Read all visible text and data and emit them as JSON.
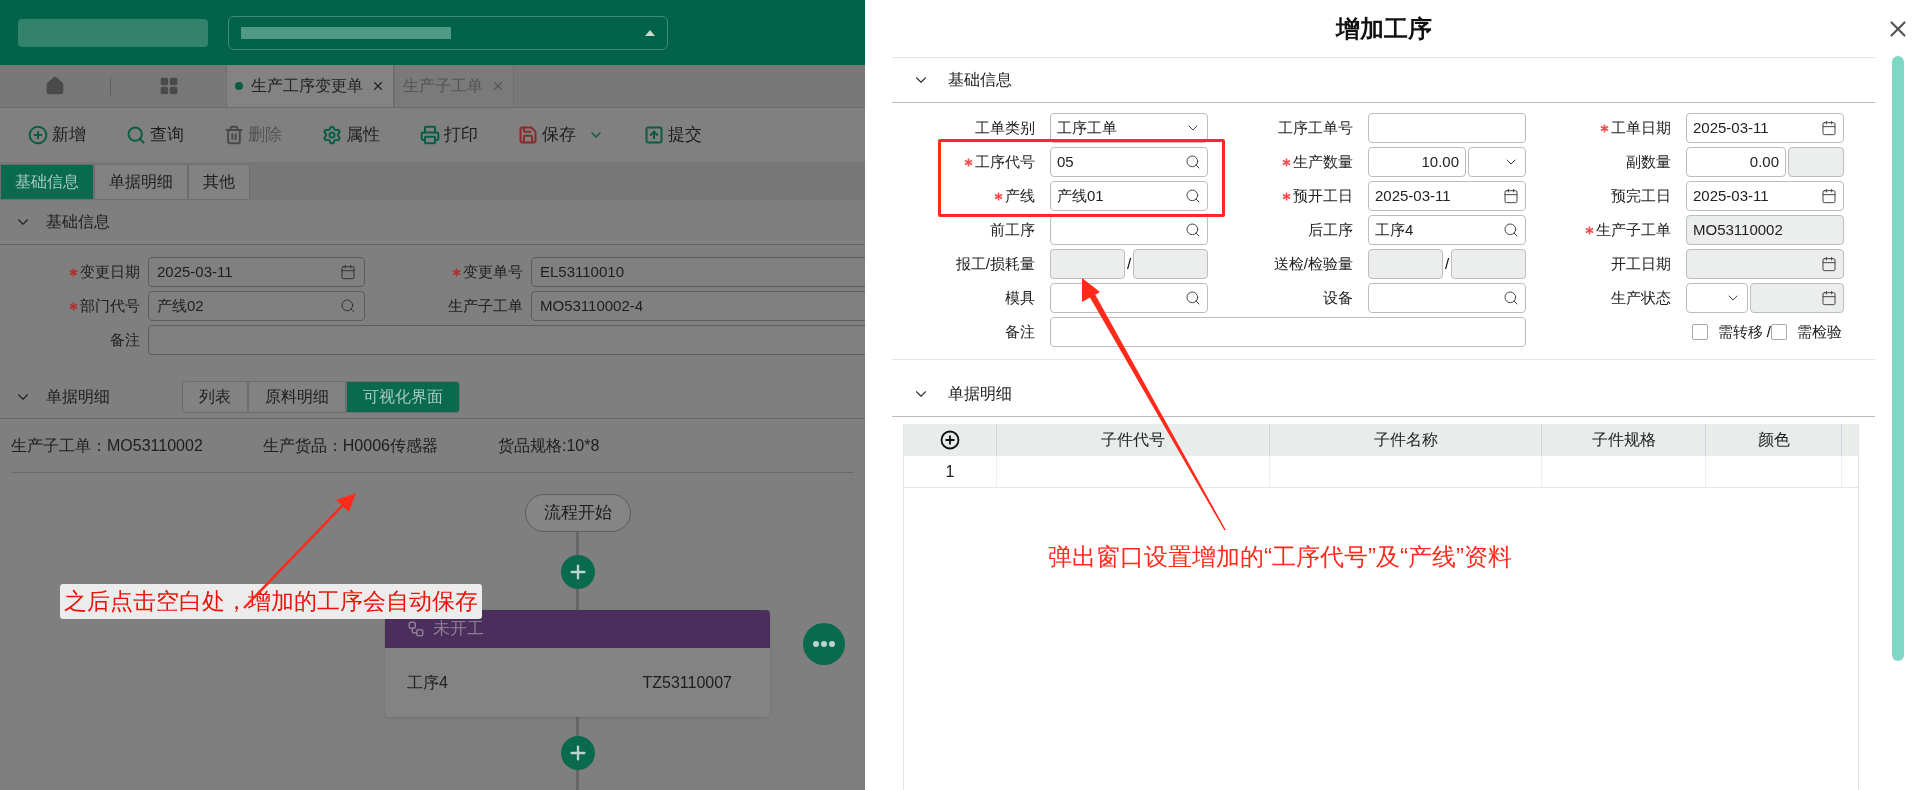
{
  "tabs": [
    {
      "label": "生产工序变更单",
      "selected": true,
      "closable": true
    },
    {
      "label": "生产子工单",
      "selected": false,
      "closable": true
    }
  ],
  "toolbar": [
    {
      "label": "新增",
      "disabled": false,
      "has_menu": false
    },
    {
      "label": "查询",
      "disabled": false,
      "has_menu": false
    },
    {
      "label": "删除",
      "disabled": true,
      "has_menu": false
    },
    {
      "label": "属性",
      "disabled": false,
      "has_menu": false
    },
    {
      "label": "打印",
      "disabled": false,
      "has_menu": false
    },
    {
      "label": "保存",
      "disabled": false,
      "has_menu": true
    },
    {
      "label": "提交",
      "disabled": false,
      "has_menu": false
    }
  ],
  "form_tabs": [
    {
      "label": "基础信息",
      "selected": true
    },
    {
      "label": "单据明细",
      "selected": false
    },
    {
      "label": "其他",
      "selected": false
    }
  ],
  "basic_section": {
    "title": "基础信息",
    "expanded": true,
    "fields": [
      {
        "label": "变更日期",
        "required": true,
        "kind": "date",
        "value": "2025-03-11"
      },
      {
        "label": "变更单号",
        "required": true,
        "kind": "text",
        "value": "EL53110010"
      },
      {
        "label": "部门代号",
        "required": true,
        "kind": "search",
        "value": "产线02"
      },
      {
        "label": "生产子工单",
        "required": false,
        "kind": "text",
        "value": "MO53110002-4"
      },
      {
        "label": "备注",
        "required": false,
        "kind": "text"
      }
    ]
  },
  "detail_section": {
    "title": "单据明细",
    "expanded": true,
    "views": [
      {
        "label": "列表",
        "selected": false
      },
      {
        "label": "原料明细",
        "selected": false
      },
      {
        "label": "可视化界面",
        "selected": true
      }
    ],
    "info": [
      "生产子工单：MO53110002",
      "生产货品：H0006传感器",
      "货品规格:10*8"
    ]
  },
  "flow": {
    "start": "流程开始",
    "steps": [
      {
        "status": "未开工",
        "name": "工序4",
        "code": "TZ53110007"
      }
    ]
  },
  "dialog": {
    "title": "增加工序",
    "basic": {
      "title": "基础信息",
      "expanded": true,
      "fields": [
        {
          "label": "工单类别",
          "required": false,
          "kind": "select",
          "value": "工序工单",
          "disabled": false
        },
        {
          "label": "工序工单号",
          "required": false,
          "kind": "text",
          "disabled": false
        },
        {
          "label": "工单日期",
          "required": true,
          "kind": "date",
          "value": "2025-03-11",
          "disabled": false
        },
        {
          "label": "工序代号",
          "required": true,
          "kind": "search",
          "value": "05",
          "disabled": false
        },
        {
          "label": "生产数量",
          "required": true,
          "kind": "number-select",
          "value": "10.00",
          "disabled": false
        },
        {
          "label": "副数量",
          "required": false,
          "kind": "number-extra",
          "value": "0.00",
          "disabled": false
        },
        {
          "label": "产线",
          "required": true,
          "kind": "search",
          "value": "产线01",
          "disabled": false
        },
        {
          "label": "预开工日",
          "required": true,
          "kind": "date",
          "value": "2025-03-11",
          "disabled": false
        },
        {
          "label": "预完工日",
          "required": false,
          "kind": "date",
          "value": "2025-03-11",
          "disabled": false
        },
        {
          "label": "前工序",
          "required": false,
          "kind": "search",
          "disabled": false
        },
        {
          "label": "后工序",
          "required": false,
          "kind": "search",
          "value": "工序4",
          "disabled": false
        },
        {
          "label": "生产子工单",
          "required": true,
          "kind": "text",
          "value": "MO53110002",
          "disabled": true
        },
        {
          "label": "报工/损耗量",
          "required": false,
          "kind": "pair",
          "separator": "/",
          "disabled": true
        },
        {
          "label": "送检/检验量",
          "required": false,
          "kind": "pair",
          "separator": "/",
          "disabled": true
        },
        {
          "label": "开工日期",
          "required": false,
          "kind": "date",
          "disabled": true
        },
        {
          "label": "模具",
          "required": false,
          "kind": "search",
          "disabled": false
        },
        {
          "label": "设备",
          "required": false,
          "kind": "search",
          "disabled": false
        },
        {
          "label": "生产状态",
          "required": false,
          "kind": "select-date",
          "disabled": false
        },
        {
          "label": "备注",
          "required": false,
          "kind": "wide",
          "disabled": false
        }
      ],
      "checkboxes": [
        {
          "label": "需转移",
          "checked": false,
          "separator": "/"
        },
        {
          "label": "需检验",
          "checked": false
        }
      ]
    },
    "detail": {
      "title": "单据明细",
      "expanded": true,
      "columns": [
        "子件代号",
        "子件名称",
        "子件规格",
        "颜色"
      ],
      "rows": [
        {
          "number": "1"
        }
      ]
    }
  },
  "annotations": [
    {
      "text": "之后点击空白处，增加的工序会自动保存"
    },
    {
      "text": "弹出窗口设置增加的“工序代号”及“产线”资料"
    }
  ]
}
